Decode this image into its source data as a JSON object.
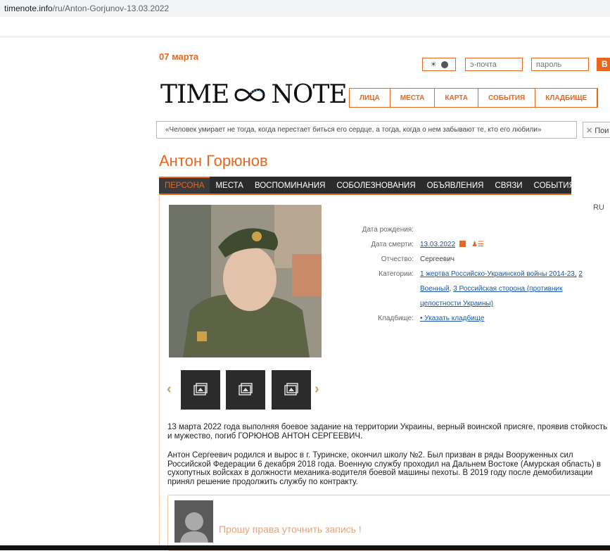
{
  "browser": {
    "url_host": "timenote.info",
    "url_path": "/ru/Anton-Gorjunov-13.03.2022"
  },
  "header": {
    "date": "07 марта",
    "email_placeholder": "э-почта",
    "password_placeholder": "пароль",
    "login_label": "В",
    "logo_left": "TIME",
    "logo_right": "NOTE",
    "nav": [
      "ЛИЦА",
      "МЕСТА",
      "КАРТА",
      "СОБЫТИЯ",
      "КЛАДБИЩЕ"
    ],
    "quote": "«Человек умирает не тогда, когда перестает биться его сердце, а тогда, когда о нем забывают те, кто его любили»",
    "search_label": "Пои"
  },
  "person": {
    "name": "Антон Горюнов",
    "tabs": [
      "ПЕРСОНА",
      "МЕСТА",
      "ВОСПОМИНАНИЯ",
      "СОБОЛЕЗНОВАНИЯ",
      "ОБЪЯВЛЕНИЯ",
      "СВЯЗИ",
      "СОБЫТИЯ"
    ],
    "lang": "RU",
    "fields": {
      "birth_label": "Дата рождения:",
      "death_label": "Дата смерти:",
      "death_value": "13.03.2022",
      "patronymic_label": "Отчество:",
      "patronymic_value": "Сергеевич",
      "categories_label": "Категории:",
      "categories_line1": "1 жертва Российско-Украинской войны 2014-23,",
      "categories_line1b": "2",
      "categories_line2a": "Военный",
      "categories_line2b": "3 Российская сторона (противник",
      "categories_line3": "целостности Украины)",
      "cemetery_label": "Кладбище:",
      "cemetery_value": "• Указать кладбище"
    },
    "bio_p1": "13 марта 2022 года выполняя боевое задание на территории Украины, верный воинской присяге, проявив стойкость и мужество, погиб ГОРЮНОВ АНТОН СЕРГЕЕВИЧ.",
    "bio_p2": "Антон Сергеевич родился и вырос в г. Туринске, окончил школу №2. Был призван в ряды Вооруженных сил Российской Федерации 6 декабря 2018 года. Военную службу проходил на Дальнем Востоке (Амурская область) в сухопутных войсках в должности механика-водителя боевой машины пехоты. В 2019 году после демобилизации принял решение продолжить службу по контракту.",
    "comment": "Прошу права уточнить запись !"
  },
  "colors": {
    "accent": "#e8661e",
    "tab_bg": "#2b2b2b",
    "link": "#1a57a8"
  }
}
